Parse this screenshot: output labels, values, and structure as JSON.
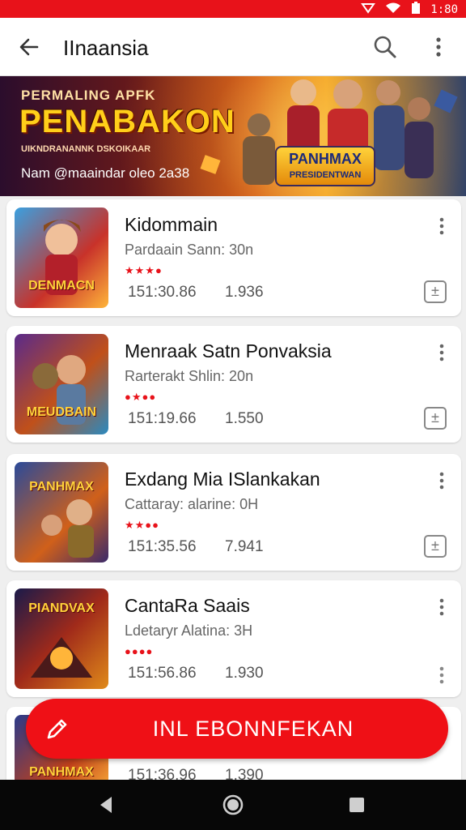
{
  "status": {
    "time": "1:80"
  },
  "appbar": {
    "title": "IInaansia"
  },
  "banner": {
    "line1": "PERMALING APFK",
    "line2": "PENABAKON",
    "line3": "UIKNDRANANNK DSKOIKAAR",
    "line4": "Nam  @maaindar oleo 2a38",
    "logo_l1": "PANHMAX",
    "logo_l2": "PRESIDENTWAN"
  },
  "apps": [
    {
      "name": "Kidommain",
      "meta": "Pardaain Sann: 30n",
      "rating": "★★★●",
      "stat1": "151:30.86",
      "stat2": "1.936",
      "thumb": "DENMACN"
    },
    {
      "name": "Menraak Satn Ponvaksia",
      "meta": "Rarterakt Shlin: 20n",
      "rating": "●★●●",
      "stat1": "151:19.66",
      "stat2": "1.550",
      "thumb": "MEUDBAIN"
    },
    {
      "name": "Exdang Mia ISlankakan",
      "meta": "Cattaray: alarine: 0H",
      "rating": "★★●●",
      "stat1": "151:35.56",
      "stat2": "7.941",
      "thumb": "PANHMAX"
    },
    {
      "name": "CantaRa Saais",
      "meta": "Ldetaryr Alatina: 3H",
      "rating": "●●●●",
      "stat1": "151:56.86",
      "stat2": "1.930",
      "thumb": "PIANDVAX"
    },
    {
      "name": "",
      "meta": "",
      "rating": "",
      "stat1": "151:36.96",
      "stat2": "1.390",
      "thumb": "PANHMAX"
    }
  ],
  "fab": {
    "label": "INL EBONNFEKAN"
  },
  "colors": {
    "accent": "#e8121a"
  }
}
